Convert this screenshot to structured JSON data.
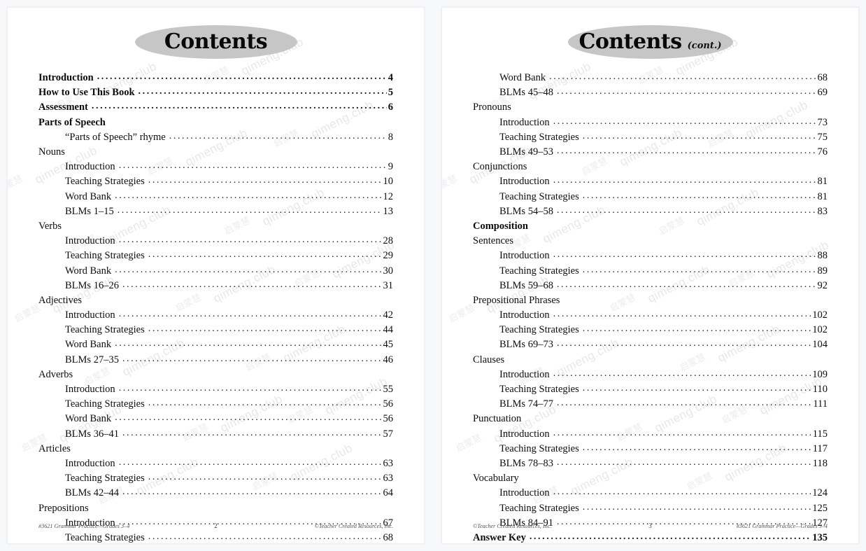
{
  "background_color": "#f7f8fa",
  "page_color": "#ffffff",
  "title_ellipse_color": "#c6c6c6",
  "watermark": {
    "latin_text": "qimeng.club",
    "cjk_text": "启蒙慧"
  },
  "left_page": {
    "title": "Contents",
    "title_suffix": "",
    "entries": [
      {
        "level": "major",
        "label": "Introduction",
        "page": "4",
        "dots": true
      },
      {
        "level": "major",
        "label": "How to Use This Book",
        "page": "5",
        "dots": true
      },
      {
        "level": "major",
        "label": "Assessment",
        "page": "6",
        "dots": true
      },
      {
        "level": "major",
        "label": "Parts of Speech",
        "page": "",
        "dots": false
      },
      {
        "level": "rhyme",
        "label": "“Parts of Speech” rhyme",
        "page": "8",
        "dots": true
      },
      {
        "level": "section",
        "label": "Nouns",
        "page": "",
        "dots": false
      },
      {
        "level": "item",
        "label": "Introduction",
        "page": "9",
        "dots": true
      },
      {
        "level": "item",
        "label": "Teaching Strategies",
        "page": "10",
        "dots": true
      },
      {
        "level": "item",
        "label": "Word Bank",
        "page": "12",
        "dots": true
      },
      {
        "level": "item",
        "label": "BLMs 1–15",
        "page": "13",
        "dots": true
      },
      {
        "level": "section",
        "label": "Verbs",
        "page": "",
        "dots": false
      },
      {
        "level": "item",
        "label": "Introduction",
        "page": "28",
        "dots": true
      },
      {
        "level": "item",
        "label": "Teaching Strategies",
        "page": "29",
        "dots": true
      },
      {
        "level": "item",
        "label": "Word Bank",
        "page": "30",
        "dots": true
      },
      {
        "level": "item",
        "label": "BLMs 16–26",
        "page": "31",
        "dots": true
      },
      {
        "level": "section",
        "label": "Adjectives",
        "page": "",
        "dots": false
      },
      {
        "level": "item",
        "label": "Introduction",
        "page": "42",
        "dots": true
      },
      {
        "level": "item",
        "label": "Teaching Strategies",
        "page": "44",
        "dots": true
      },
      {
        "level": "item",
        "label": "Word Bank",
        "page": "45",
        "dots": true
      },
      {
        "level": "item",
        "label": "BLMs 27–35",
        "page": "46",
        "dots": true
      },
      {
        "level": "section",
        "label": "Adverbs",
        "page": "",
        "dots": false
      },
      {
        "level": "item",
        "label": "Introduction",
        "page": "55",
        "dots": true
      },
      {
        "level": "item",
        "label": "Teaching Strategies",
        "page": "56",
        "dots": true
      },
      {
        "level": "item",
        "label": "Word Bank",
        "page": "56",
        "dots": true
      },
      {
        "level": "item",
        "label": "BLMs 36–41",
        "page": "57",
        "dots": true
      },
      {
        "level": "section",
        "label": "Articles",
        "page": "",
        "dots": false
      },
      {
        "level": "item",
        "label": "Introduction",
        "page": "63",
        "dots": true
      },
      {
        "level": "item",
        "label": "Teaching Strategies",
        "page": "63",
        "dots": true
      },
      {
        "level": "item",
        "label": "BLMs 42–44",
        "page": "64",
        "dots": true
      },
      {
        "level": "section",
        "label": "Prepositions",
        "page": "",
        "dots": false
      },
      {
        "level": "item",
        "label": "Introduction",
        "page": "67",
        "dots": true
      },
      {
        "level": "item",
        "label": "Teaching Strategies",
        "page": "68",
        "dots": true
      }
    ],
    "footer": {
      "left": "#3621 Grammar Practice—Grades 3–4",
      "center": "2",
      "right": "©Teacher Created Resources, Inc."
    }
  },
  "right_page": {
    "title": "Contents",
    "title_suffix": "(cont.)",
    "entries": [
      {
        "level": "item",
        "label": "Word Bank",
        "page": "68",
        "dots": true
      },
      {
        "level": "item",
        "label": "BLMs 45–48",
        "page": "69",
        "dots": true
      },
      {
        "level": "section",
        "label": "Pronouns",
        "page": "",
        "dots": false
      },
      {
        "level": "item",
        "label": "Introduction",
        "page": "73",
        "dots": true
      },
      {
        "level": "item",
        "label": "Teaching Strategies",
        "page": "75",
        "dots": true
      },
      {
        "level": "item",
        "label": "BLMs 49–53",
        "page": "76",
        "dots": true
      },
      {
        "level": "section",
        "label": "Conjunctions",
        "page": "",
        "dots": false
      },
      {
        "level": "item",
        "label": "Introduction",
        "page": "81",
        "dots": true
      },
      {
        "level": "item",
        "label": "Teaching Strategies",
        "page": "81",
        "dots": true
      },
      {
        "level": "item",
        "label": "BLMs 54–58",
        "page": "83",
        "dots": true
      },
      {
        "level": "major",
        "label": "Composition",
        "page": "",
        "dots": false
      },
      {
        "level": "section",
        "label": "Sentences",
        "page": "",
        "dots": false
      },
      {
        "level": "item",
        "label": "Introduction",
        "page": "88",
        "dots": true
      },
      {
        "level": "item",
        "label": "Teaching Strategies",
        "page": "89",
        "dots": true
      },
      {
        "level": "item",
        "label": "BLMs 59–68",
        "page": "92",
        "dots": true
      },
      {
        "level": "section",
        "label": "Prepositional Phrases",
        "page": "",
        "dots": false
      },
      {
        "level": "item",
        "label": "Introduction",
        "page": "102",
        "dots": true
      },
      {
        "level": "item",
        "label": "Teaching Strategies",
        "page": "102",
        "dots": true
      },
      {
        "level": "item",
        "label": "BLMs 69–73",
        "page": "104",
        "dots": true
      },
      {
        "level": "section",
        "label": "Clauses",
        "page": "",
        "dots": false
      },
      {
        "level": "item",
        "label": "Introduction",
        "page": "109",
        "dots": true
      },
      {
        "level": "item",
        "label": "Teaching Strategies",
        "page": "110",
        "dots": true
      },
      {
        "level": "item",
        "label": "BLMs 74–77",
        "page": "111",
        "dots": true
      },
      {
        "level": "section",
        "label": "Punctuation",
        "page": "",
        "dots": false
      },
      {
        "level": "item",
        "label": "Introduction",
        "page": "115",
        "dots": true
      },
      {
        "level": "item",
        "label": "Teaching Strategies",
        "page": "117",
        "dots": true
      },
      {
        "level": "item",
        "label": "BLMs 78–83",
        "page": "118",
        "dots": true
      },
      {
        "level": "section",
        "label": "Vocabulary",
        "page": "",
        "dots": false
      },
      {
        "level": "item",
        "label": "Introduction",
        "page": "124",
        "dots": true
      },
      {
        "level": "item",
        "label": "Teaching Strategies",
        "page": "125",
        "dots": true
      },
      {
        "level": "item",
        "label": "BLMs 84–91",
        "page": "127",
        "dots": true
      },
      {
        "level": "major",
        "label": "Answer Key",
        "page": "135",
        "dots": true
      }
    ],
    "footer": {
      "left": "©Teacher Created Resources, Inc.",
      "center": "3",
      "right": "#3621 Grammar Practice—Grades 3–4"
    }
  }
}
